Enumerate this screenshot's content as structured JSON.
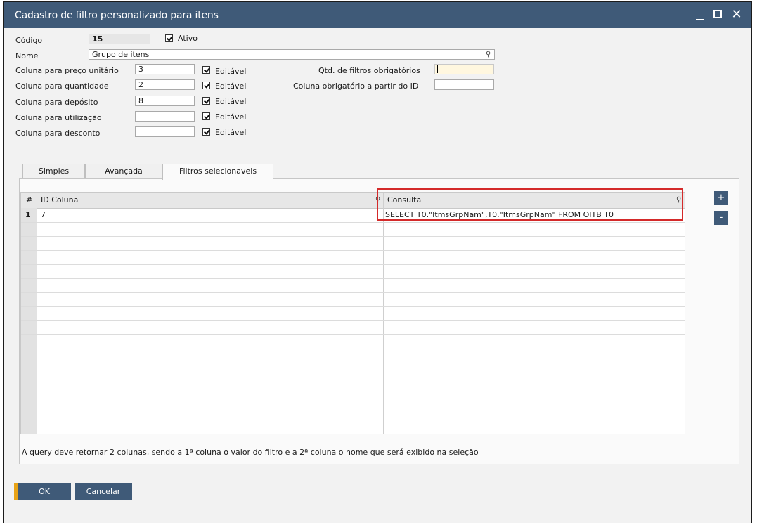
{
  "window": {
    "title": "Cadastro de filtro personalizado para itens",
    "controls": {
      "minimize": "_",
      "maximize": "□",
      "close": "✕"
    }
  },
  "form": {
    "codigo_label": "Código",
    "codigo_value": "15",
    "ativo_label": "Ativo",
    "nome_label": "Nome",
    "nome_value": "Grupo de itens",
    "rows": [
      {
        "label": "Coluna para preço unitário",
        "value": "3",
        "editavel": "Editável"
      },
      {
        "label": "Coluna para quantidade",
        "value": "2",
        "editavel": "Editável"
      },
      {
        "label": "Coluna para depósito",
        "value": "8",
        "editavel": "Editável"
      },
      {
        "label": "Coluna para utilização",
        "value": "",
        "editavel": "Editável"
      },
      {
        "label": "Coluna para desconto",
        "value": "",
        "editavel": "Editável"
      }
    ],
    "qtd_filtros_label": "Qtd. de filtros obrigatórios",
    "qtd_filtros_value": "",
    "coluna_obrig_label": "Coluna obrigatório a partir do ID",
    "coluna_obrig_value": ""
  },
  "tabs": [
    {
      "label": "Simples"
    },
    {
      "label": "Avançada"
    },
    {
      "label": "Filtros selecionaveis"
    }
  ],
  "grid": {
    "columns": {
      "num": "#",
      "id_coluna": "ID Coluna",
      "consulta": "Consulta"
    },
    "rows": [
      {
        "num": "1",
        "id_coluna": "7",
        "consulta": "SELECT T0.\"ItmsGrpNam\",T0.\"ItmsGrpNam\" FROM OITB T0"
      }
    ],
    "add_label": "+",
    "remove_label": "-"
  },
  "note": "A query deve retornar 2 colunas, sendo a 1ª coluna o valor do filtro e a 2ª coluna o nome que será exibido na seleção",
  "buttons": {
    "ok": "OK",
    "cancel": "Cancelar"
  },
  "colors": {
    "titlebar": "#3f5a78",
    "accent": "#e8a317",
    "highlight": "#d42a2a"
  }
}
